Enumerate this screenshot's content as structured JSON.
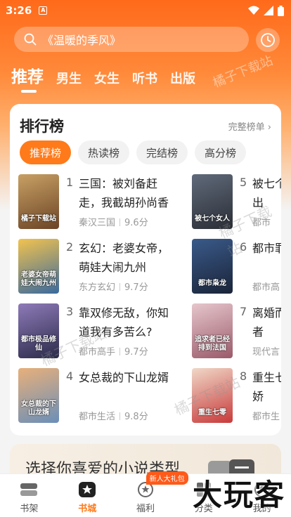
{
  "status_bar": {
    "time": "3:26",
    "notif_icon": "A"
  },
  "search": {
    "placeholder": "《温暖的季风》"
  },
  "tabs": [
    {
      "label": "推荐",
      "active": true
    },
    {
      "label": "男生"
    },
    {
      "label": "女生"
    },
    {
      "label": "听书"
    },
    {
      "label": "出版"
    }
  ],
  "hero_watermark": "橘子下载站",
  "ranking": {
    "title": "排行榜",
    "more": "完整榜单",
    "chips": [
      "推荐榜",
      "热读榜",
      "完结榜",
      "高分榜"
    ],
    "books_left": [
      {
        "rank": "1",
        "title": "三国：被刘备赶走，我截胡孙尚香",
        "genre": "秦汉三国",
        "score": "9.6分",
        "cover_text": "橘子下载站",
        "cover_colors": [
          "#c8a064",
          "#6b4426"
        ]
      },
      {
        "rank": "2",
        "title": "玄幻：老婆女帝，萌娃大闹九州",
        "genre": "东方玄幻",
        "score": "9.7分",
        "cover_text": "老婆女帝萌娃大闹九州",
        "cover_colors": [
          "#f2c34e",
          "#3a6a9e"
        ]
      },
      {
        "rank": "3",
        "title": "靠双修无敌，你知道我有多苦么?",
        "genre": "都市高手",
        "score": "9.7分",
        "cover_text": "都市极品修仙",
        "cover_colors": [
          "#8e7ab8",
          "#2b2b4a"
        ]
      },
      {
        "rank": "4",
        "title": "女总裁的下山龙婿",
        "genre": "都市生活",
        "score": "9.8分",
        "cover_text": "女总裁的下山龙婿",
        "cover_colors": [
          "#e8b07a",
          "#6a8fb8"
        ]
      }
    ],
    "books_right": [
      {
        "rank": "5",
        "title": "被七个害，出",
        "genre": "都市",
        "cover_text": "被七个女人",
        "cover_colors": [
          "#606a7a",
          "#2a2e36"
        ]
      },
      {
        "rank": "6",
        "title": "都市罪",
        "genre": "都市高",
        "cover_text": "都市枭龙",
        "cover_colors": [
          "#3a5a8a",
          "#1a2438"
        ]
      },
      {
        "rank": "7",
        "title": "离婚而追求者",
        "genre": "现代言",
        "cover_text": "追求者已经排到法国",
        "cover_colors": [
          "#e6c6cc",
          "#9a5a6a"
        ]
      },
      {
        "rank": "8",
        "title": "重生七猎养娇",
        "genre": "都市生",
        "cover_text": "重生七零",
        "cover_colors": [
          "#f0d8c8",
          "#c83a3a"
        ]
      }
    ]
  },
  "promo": {
    "text": "选择你喜爱的小说类型"
  },
  "bottom_nav": [
    {
      "label": "书架",
      "icon": "bookshelf-icon"
    },
    {
      "label": "书城",
      "icon": "store-icon",
      "active": true
    },
    {
      "label": "福利",
      "icon": "gift-icon",
      "badge": "新人大礼包"
    },
    {
      "label": "分类",
      "icon": "category-icon"
    },
    {
      "label": "我的",
      "icon": "profile-icon"
    }
  ],
  "corner_watermark": "大玩客",
  "content_watermark": "橘子下载站",
  "colors": {
    "accent": "#ff7a1a",
    "hero_top": "#ff6a1a"
  }
}
